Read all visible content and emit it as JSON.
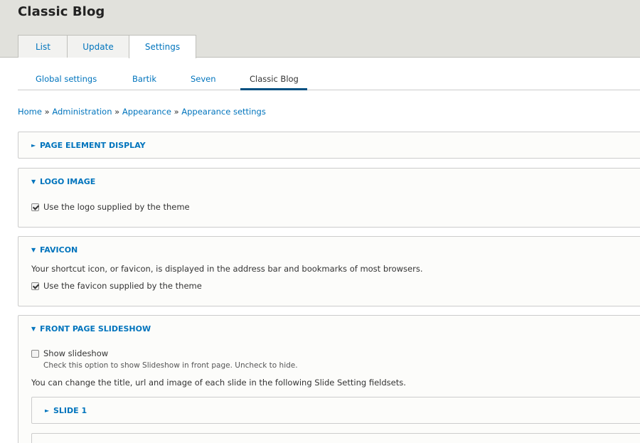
{
  "header": {
    "title": "Classic Blog",
    "tabs": [
      {
        "label": "List"
      },
      {
        "label": "Update"
      },
      {
        "label": "Settings"
      }
    ]
  },
  "subtabs": [
    {
      "label": "Global settings"
    },
    {
      "label": "Bartik"
    },
    {
      "label": "Seven"
    },
    {
      "label": "Classic Blog"
    }
  ],
  "breadcrumb": {
    "items": [
      "Home",
      "Administration",
      "Appearance",
      "Appearance settings"
    ],
    "separator": "»"
  },
  "sections": {
    "page_element_display": {
      "legend": "PAGE ELEMENT DISPLAY",
      "expanded": false
    },
    "logo_image": {
      "legend": "LOGO IMAGE",
      "expanded": true,
      "checkbox_label": "Use the logo supplied by the theme",
      "checked": true
    },
    "favicon": {
      "legend": "FAVICON",
      "expanded": true,
      "description": "Your shortcut icon, or favicon, is displayed in the address bar and bookmarks of most browsers.",
      "checkbox_label": "Use the favicon supplied by the theme",
      "checked": true
    },
    "front_page_slideshow": {
      "legend": "FRONT PAGE SLIDESHOW",
      "expanded": true,
      "checkbox_label": "Show slideshow",
      "checked": false,
      "checkbox_description": "Check this option to show Slideshow in front page. Uncheck to hide.",
      "help_text": "You can change the title, url and image of each slide in the following Slide Setting fieldsets.",
      "slide1_legend": "SLIDE 1"
    }
  },
  "glyphs": {
    "collapsed": "►",
    "expanded": "▼"
  },
  "colors": {
    "link": "#0074bd",
    "header_bg": "#e1e1dc",
    "active_underline": "#004f80"
  }
}
